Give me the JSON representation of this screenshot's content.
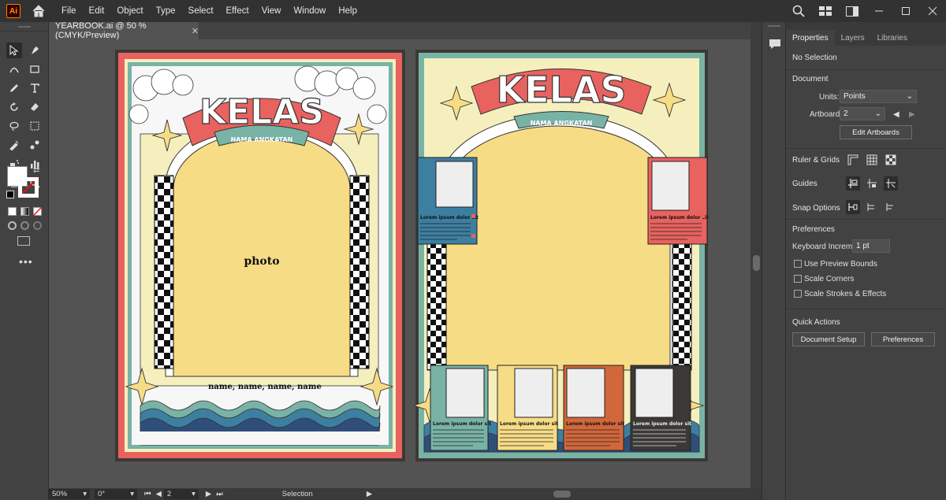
{
  "app": {
    "logo": "Ai"
  },
  "menu": [
    "File",
    "Edit",
    "Object",
    "Type",
    "Select",
    "Effect",
    "View",
    "Window",
    "Help"
  ],
  "document_tab": {
    "title": "YEARBOOK.ai @ 50 % (CMYK/Preview)"
  },
  "artboard_left": {
    "title": "KELAS",
    "subtitle": "NAMA ANGKATAN",
    "photo_label": "photo",
    "names": "name, name, name, name"
  },
  "artboard_right": {
    "title": "KELAS",
    "subtitle": "NAMA ANGKATAN",
    "card_title": "Lorem ipsum dolor sit",
    "card_body": "Lorem ipsum dolor sit amet, consectetur adipiscing elit. Cras sit amet dui ultricies, luctus odio id, consequat arcu. Morbi in orci at ipsum vulputate luctus auctor ultricies. Fusce."
  },
  "status": {
    "zoom": "50%",
    "rotation": "0°",
    "artboard": "2",
    "tool": "Selection"
  },
  "properties_panel": {
    "tabs": [
      "Properties",
      "Layers",
      "Libraries"
    ],
    "selection": "No Selection",
    "document_header": "Document",
    "units_label": "Units:",
    "units_value": "Points",
    "artboard_label": "Artboard:",
    "artboard_value": "2",
    "edit_artboards": "Edit Artboards",
    "ruler_grids": "Ruler & Grids",
    "guides": "Guides",
    "snap_options": "Snap Options",
    "preferences_header": "Preferences",
    "keyboard_increment_label": "Keyboard Increment:",
    "keyboard_increment_value": "1 pt",
    "use_preview_bounds": "Use Preview Bounds",
    "scale_corners": "Scale Corners",
    "scale_strokes": "Scale Strokes & Effects",
    "quick_actions": "Quick Actions",
    "document_setup": "Document Setup",
    "preferences_button": "Preferences"
  },
  "colors": {
    "app_bg": "#535353",
    "red": "#e8625f",
    "teal": "#78b3a6",
    "cream": "#f5efbe",
    "yellow": "#f7dc86",
    "blue": "#3d7fa1",
    "navy": "#2f4e7a",
    "orange": "#d1673b",
    "dark": "#3b3935"
  }
}
